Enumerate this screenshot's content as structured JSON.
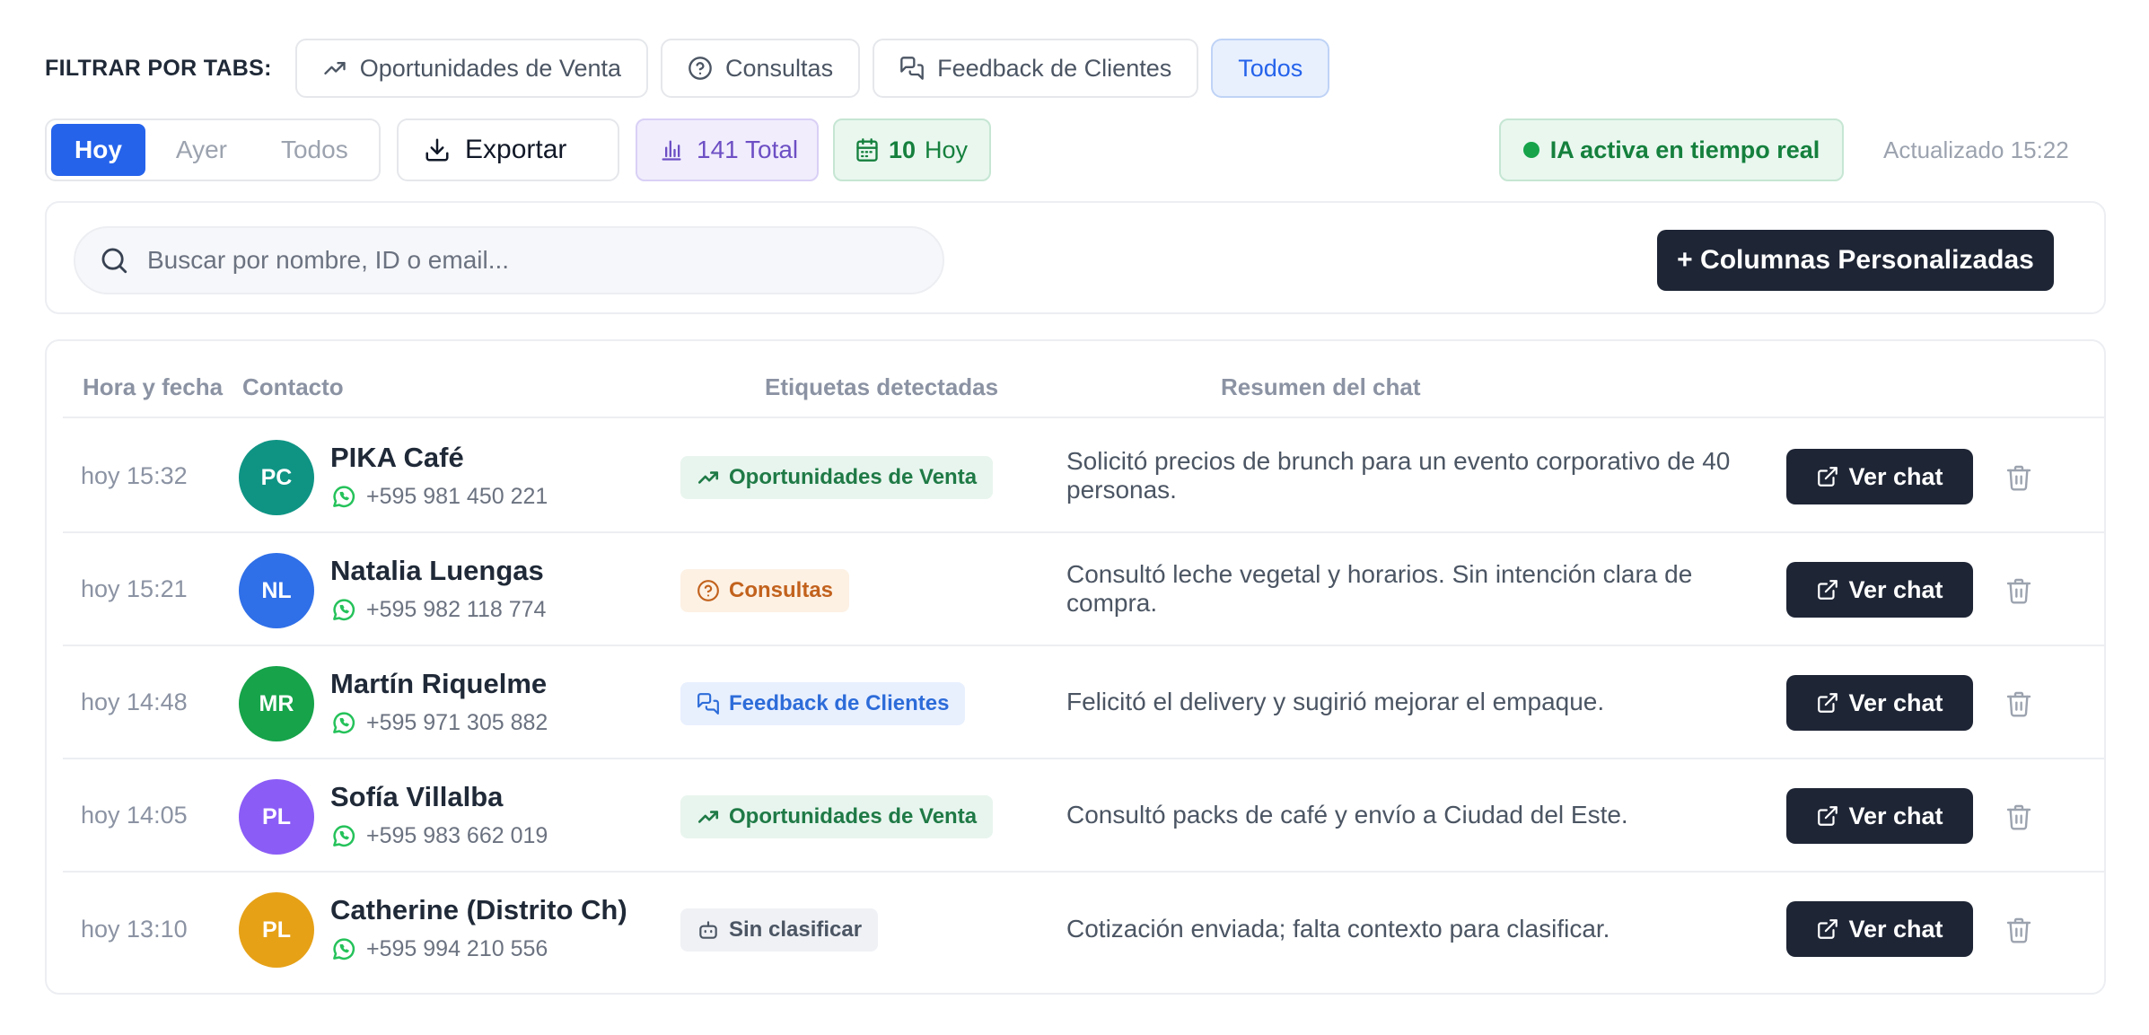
{
  "filters": {
    "label": "FILTRAR POR TABS:",
    "tabs": [
      {
        "label": "Oportunidades de Venta",
        "icon": "trending-up-icon",
        "active": false
      },
      {
        "label": "Consultas",
        "icon": "help-circle-icon",
        "active": false
      },
      {
        "label": "Feedback de Clientes",
        "icon": "chat-bubbles-icon",
        "active": false
      },
      {
        "label": "Todos",
        "icon": "",
        "active": true
      }
    ]
  },
  "toolbar": {
    "date_segments": [
      {
        "label": "Hoy",
        "active": true
      },
      {
        "label": "Ayer",
        "active": false
      },
      {
        "label": "Todos",
        "active": false
      }
    ],
    "export_label": "Exportar",
    "total_label": "141 Total",
    "today_count": "10",
    "today_label": "Hoy",
    "ia_status": "IA activa en tiempo real",
    "updated": "Actualizado 15:22"
  },
  "search": {
    "placeholder": "Buscar por nombre, ID o email...",
    "add_columns_label": "+ Columnas Personalizadas"
  },
  "table": {
    "headers": {
      "time": "Hora y fecha",
      "contact": "Contacto",
      "tags": "Etiquetas detectadas",
      "summary": "Resumen del chat"
    },
    "view_label": "Ver chat",
    "rows": [
      {
        "time": "hoy 15:32",
        "initials": "PC",
        "avatar_color": "#0f9484",
        "name": "PIKA Café",
        "phone": "+595 981 450 221",
        "tag": "Oportunidades de Venta",
        "tag_type": "sales",
        "summary": "Solicitó precios de brunch para un evento corporativo de 40 personas."
      },
      {
        "time": "hoy 15:21",
        "initials": "NL",
        "avatar_color": "#2f6fe8",
        "name": "Natalia Luengas",
        "phone": "+595 982 118 774",
        "tag": "Consultas",
        "tag_type": "consult",
        "summary": "Consultó leche vegetal y horarios. Sin intención clara de compra."
      },
      {
        "time": "hoy 14:48",
        "initials": "MR",
        "avatar_color": "#16a34a",
        "name": "Martín Riquelme",
        "phone": "+595 971 305 882",
        "tag": "Feedback de Clientes",
        "tag_type": "feedback",
        "summary": "Felicitó el delivery y sugirió mejorar el empaque."
      },
      {
        "time": "hoy 14:05",
        "initials": "PL",
        "avatar_color": "#8b5cf6",
        "name": "Sofía Villalba",
        "phone": "+595 983 662 019",
        "tag": "Oportunidades de Venta",
        "tag_type": "sales",
        "summary": "Consultó packs de café y envío a Ciudad del Este."
      },
      {
        "time": "hoy 13:10",
        "initials": "PL",
        "avatar_color": "#e6a117",
        "name": "Catherine (Distrito Ch)",
        "phone": "+595 994 210 556",
        "tag": "Sin clasificar",
        "tag_type": "none",
        "summary": "Cotización enviada; falta contexto para clasificar."
      }
    ]
  }
}
